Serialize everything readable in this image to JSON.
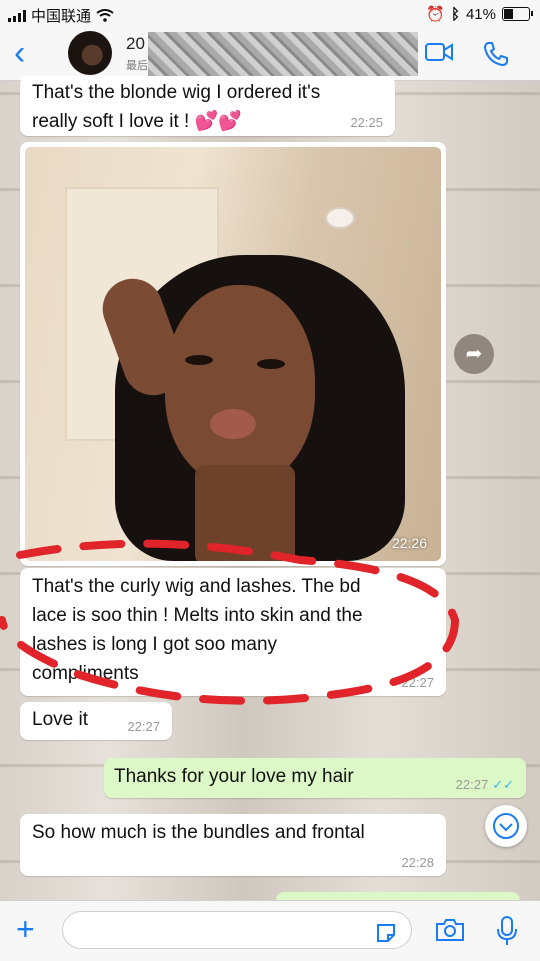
{
  "status": {
    "carrier": "中国联通",
    "battery_percent": "41%",
    "battery_level": 0.41
  },
  "header": {
    "contact_name_partial": "20",
    "contact_sub_partial": "最后"
  },
  "messages": [
    {
      "id": "m1",
      "direction": "in",
      "text_lines": [
        "That's the blonde wig I ordered it's",
        "really soft I love it ! 💕💕"
      ],
      "time": "22:25"
    },
    {
      "id": "m2",
      "direction": "in",
      "type": "photo",
      "time": "22:26"
    },
    {
      "id": "m3",
      "direction": "in",
      "text_lines": [
        "That's the curly wig and lashes. The bd",
        "lace is soo thin ! Melts into skin and the",
        "lashes is long I got soo many",
        "compliments"
      ],
      "time": "22:27"
    },
    {
      "id": "m4",
      "direction": "in",
      "text_lines": [
        "Love it"
      ],
      "time": "22:27"
    },
    {
      "id": "m5",
      "direction": "out",
      "text_lines": [
        "Thanks for your love my hair"
      ],
      "time": "22:27",
      "read": true
    },
    {
      "id": "m6",
      "direction": "in",
      "text_lines": [
        "So how much is the bundles and frontal"
      ],
      "time": "22:28"
    }
  ],
  "composer": {
    "placeholder": ""
  },
  "colors": {
    "accent": "#1a7cf2",
    "outgoing_bubble": "#dcf8c6",
    "annotation": "#e0242a"
  },
  "icons": {
    "back": "chevron-left-icon",
    "video": "video-call-icon",
    "call": "phone-icon",
    "forward": "forward-icon",
    "scroll": "chevron-down-icon",
    "attach": "plus-icon",
    "sticker": "sticker-icon",
    "camera": "camera-icon",
    "mic": "microphone-icon"
  }
}
